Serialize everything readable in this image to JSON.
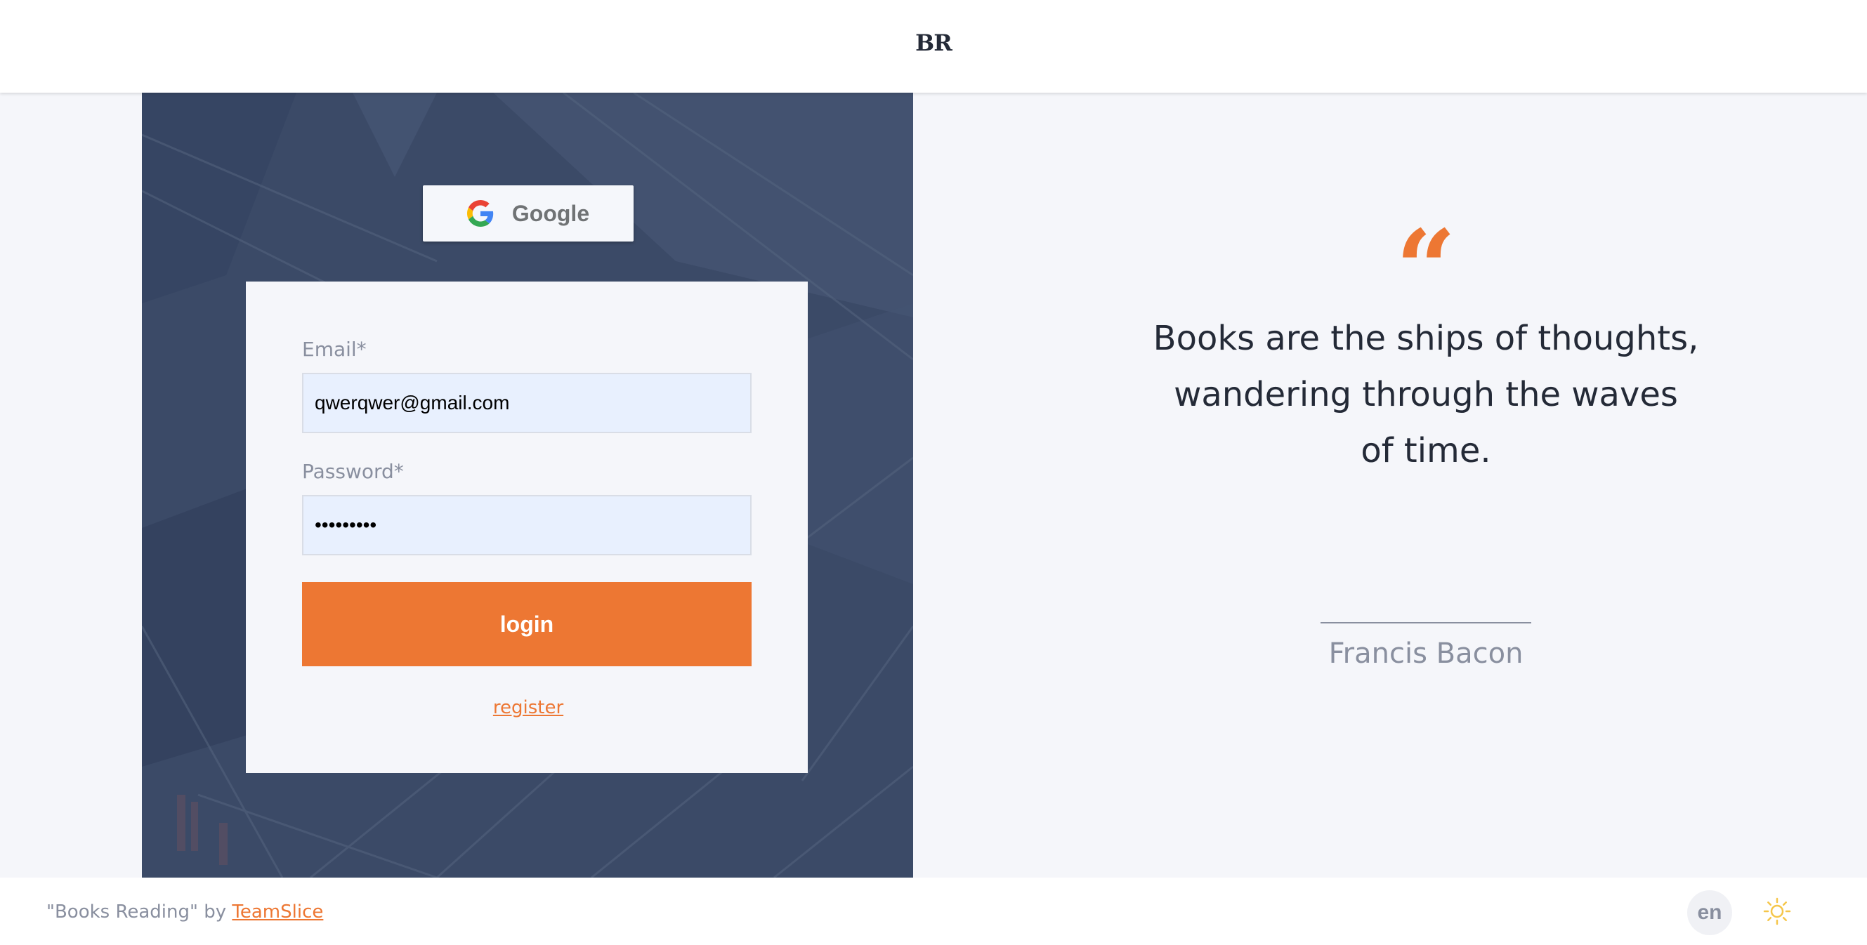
{
  "header": {
    "logo": "BR"
  },
  "login": {
    "google_label": "Google",
    "email_label": "Email*",
    "email_value": "qwerqwer@gmail.com",
    "password_label": "Password*",
    "password_value": "qwerqwer1",
    "login_label": "login",
    "register_label": "register"
  },
  "quote": {
    "mark": "“",
    "text_lines": [
      "Books are the ships of thoughts,",
      "wandering through the waves",
      "of time."
    ],
    "author": "Francis Bacon"
  },
  "footer": {
    "credit_prefix": "\"Books Reading\" by",
    "credit_link": "TeamSlice",
    "lang": "en"
  },
  "colors": {
    "accent": "#ed7733",
    "panel": "#3a4a68",
    "text_dark": "#242a37",
    "text_muted": "#898f9f",
    "page_bg": "#f5f6fa",
    "theme_icon": "#f5c64a"
  },
  "icons": {
    "google": "google-g-icon",
    "theme": "sun-icon"
  }
}
